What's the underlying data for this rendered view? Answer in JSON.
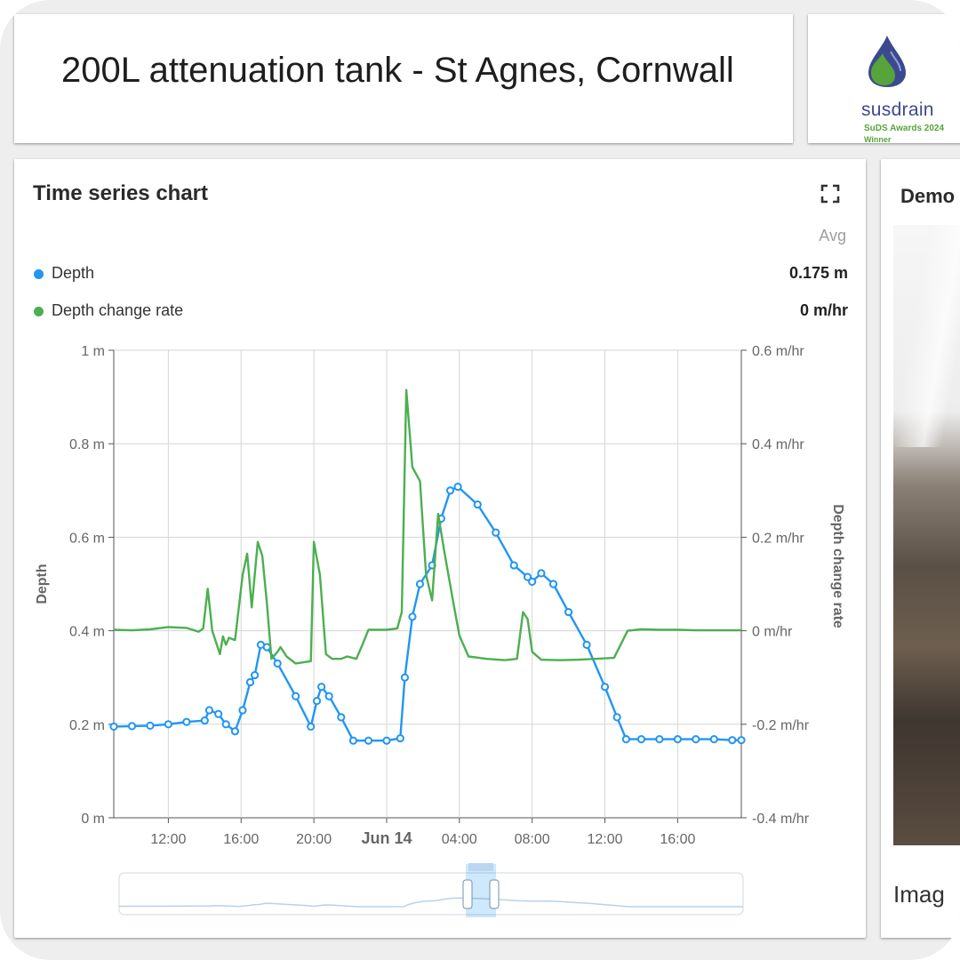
{
  "header": {
    "title": "200L attenuation tank - St Agnes, Cornwall"
  },
  "logo": {
    "wordmark": "susdrain",
    "line1": "SuDS Awards 2024",
    "line2": "Winner",
    "colors": {
      "drop_blue": "#3b4a8f",
      "drop_green": "#56a43a"
    }
  },
  "chart_widget": {
    "title": "Time series chart",
    "expand_icon": "fullscreen-icon",
    "avg_label": "Avg",
    "legend": [
      {
        "name": "Depth",
        "avg": "0.175 m",
        "color": "#2196f3"
      },
      {
        "name": "Depth change rate",
        "avg": "0 m/hr",
        "color": "#4caf50"
      }
    ]
  },
  "side_widget": {
    "title": "Demo",
    "caption": "Imag"
  },
  "chart_data": {
    "type": "line",
    "title": "",
    "xlabel": "",
    "ylabel": "Depth",
    "y2label": "Depth change rate",
    "ylim": [
      0,
      1
    ],
    "y2lim": [
      -0.4,
      0.6
    ],
    "xlim": [
      "2024-06-13T09:00",
      "2024-06-14T19:30"
    ],
    "yticks": [
      "0 m",
      "0.2 m",
      "0.4 m",
      "0.6 m",
      "0.8 m",
      "1 m"
    ],
    "y2ticks": [
      "-0.4 m/hr",
      "-0.2 m/hr",
      "0 m/hr",
      "0.2 m/hr",
      "0.4 m/hr",
      "0.6 m/hr"
    ],
    "xticks": [
      {
        "t": "2024-06-13T12:00",
        "label": "12:00"
      },
      {
        "t": "2024-06-13T16:00",
        "label": "16:00"
      },
      {
        "t": "2024-06-13T20:00",
        "label": "20:00"
      },
      {
        "t": "2024-06-14T00:00",
        "label": "Jun 14"
      },
      {
        "t": "2024-06-14T04:00",
        "label": "04:00"
      },
      {
        "t": "2024-06-14T08:00",
        "label": "08:00"
      },
      {
        "t": "2024-06-14T12:00",
        "label": "12:00"
      },
      {
        "t": "2024-06-14T16:00",
        "label": "16:00"
      }
    ],
    "grid": true,
    "series": [
      {
        "name": "Depth",
        "axis": "left",
        "color": "#2196f3",
        "markers": true,
        "points": [
          [
            "2024-06-13T09:00",
            0.195
          ],
          [
            "2024-06-13T10:00",
            0.196
          ],
          [
            "2024-06-13T11:00",
            0.197
          ],
          [
            "2024-06-13T12:00",
            0.2
          ],
          [
            "2024-06-13T13:00",
            0.205
          ],
          [
            "2024-06-13T14:00",
            0.208
          ],
          [
            "2024-06-13T14:15",
            0.23
          ],
          [
            "2024-06-13T14:45",
            0.222
          ],
          [
            "2024-06-13T15:10",
            0.2
          ],
          [
            "2024-06-13T15:40",
            0.185
          ],
          [
            "2024-06-13T16:05",
            0.23
          ],
          [
            "2024-06-13T16:30",
            0.29
          ],
          [
            "2024-06-13T16:45",
            0.305
          ],
          [
            "2024-06-13T17:05",
            0.37
          ],
          [
            "2024-06-13T17:25",
            0.365
          ],
          [
            "2024-06-13T18:00",
            0.33
          ],
          [
            "2024-06-13T19:00",
            0.26
          ],
          [
            "2024-06-13T19:50",
            0.195
          ],
          [
            "2024-06-13T20:10",
            0.25
          ],
          [
            "2024-06-13T20:25",
            0.28
          ],
          [
            "2024-06-13T20:50",
            0.26
          ],
          [
            "2024-06-13T21:30",
            0.215
          ],
          [
            "2024-06-13T22:10",
            0.165
          ],
          [
            "2024-06-13T23:00",
            0.165
          ],
          [
            "2024-06-14T00:00",
            0.165
          ],
          [
            "2024-06-14T00:45",
            0.17
          ],
          [
            "2024-06-14T01:00",
            0.3
          ],
          [
            "2024-06-14T01:25",
            0.43
          ],
          [
            "2024-06-14T01:50",
            0.5
          ],
          [
            "2024-06-14T02:30",
            0.54
          ],
          [
            "2024-06-14T03:00",
            0.64
          ],
          [
            "2024-06-14T03:30",
            0.7
          ],
          [
            "2024-06-14T03:55",
            0.708
          ],
          [
            "2024-06-14T05:00",
            0.67
          ],
          [
            "2024-06-14T06:00",
            0.61
          ],
          [
            "2024-06-14T07:00",
            0.54
          ],
          [
            "2024-06-14T07:45",
            0.515
          ],
          [
            "2024-06-14T08:00",
            0.505
          ],
          [
            "2024-06-14T08:30",
            0.523
          ],
          [
            "2024-06-14T09:10",
            0.5
          ],
          [
            "2024-06-14T10:00",
            0.44
          ],
          [
            "2024-06-14T11:00",
            0.37
          ],
          [
            "2024-06-14T12:00",
            0.28
          ],
          [
            "2024-06-14T12:40",
            0.215
          ],
          [
            "2024-06-14T13:10",
            0.168
          ],
          [
            "2024-06-14T14:00",
            0.168
          ],
          [
            "2024-06-14T15:00",
            0.168
          ],
          [
            "2024-06-14T16:00",
            0.168
          ],
          [
            "2024-06-14T17:00",
            0.168
          ],
          [
            "2024-06-14T18:00",
            0.168
          ],
          [
            "2024-06-14T19:00",
            0.166
          ],
          [
            "2024-06-14T19:30",
            0.166
          ]
        ]
      },
      {
        "name": "Depth change rate",
        "axis": "right",
        "color": "#4caf50",
        "markers": false,
        "points": [
          [
            "2024-06-13T09:00",
            0.002
          ],
          [
            "2024-06-13T10:00",
            0.001
          ],
          [
            "2024-06-13T11:00",
            0.003
          ],
          [
            "2024-06-13T12:00",
            0.008
          ],
          [
            "2024-06-13T13:00",
            0.006
          ],
          [
            "2024-06-13T13:40",
            -0.002
          ],
          [
            "2024-06-13T13:55",
            0.005
          ],
          [
            "2024-06-13T14:10",
            0.09
          ],
          [
            "2024-06-13T14:25",
            0.0
          ],
          [
            "2024-06-13T14:50",
            -0.05
          ],
          [
            "2024-06-13T15:00",
            -0.012
          ],
          [
            "2024-06-13T15:10",
            -0.03
          ],
          [
            "2024-06-13T15:20",
            -0.015
          ],
          [
            "2024-06-13T15:40",
            -0.02
          ],
          [
            "2024-06-13T16:05",
            0.12
          ],
          [
            "2024-06-13T16:20",
            0.165
          ],
          [
            "2024-06-13T16:35",
            0.05
          ],
          [
            "2024-06-13T16:55",
            0.19
          ],
          [
            "2024-06-13T17:10",
            0.16
          ],
          [
            "2024-06-13T17:25",
            0.06
          ],
          [
            "2024-06-13T17:40",
            -0.06
          ],
          [
            "2024-06-13T18:00",
            -0.045
          ],
          [
            "2024-06-13T18:10",
            -0.035
          ],
          [
            "2024-06-13T18:30",
            -0.055
          ],
          [
            "2024-06-13T19:00",
            -0.07
          ],
          [
            "2024-06-13T19:50",
            -0.065
          ],
          [
            "2024-06-13T20:00",
            0.19
          ],
          [
            "2024-06-13T20:20",
            0.12
          ],
          [
            "2024-06-13T20:40",
            -0.05
          ],
          [
            "2024-06-13T21:00",
            -0.06
          ],
          [
            "2024-06-13T21:30",
            -0.06
          ],
          [
            "2024-06-13T21:50",
            -0.055
          ],
          [
            "2024-06-13T22:20",
            -0.06
          ],
          [
            "2024-06-13T22:40",
            -0.03
          ],
          [
            "2024-06-13T23:00",
            0.002
          ],
          [
            "2024-06-14T00:00",
            0.002
          ],
          [
            "2024-06-14T00:35",
            0.005
          ],
          [
            "2024-06-14T00:50",
            0.04
          ],
          [
            "2024-06-14T01:05",
            0.515
          ],
          [
            "2024-06-14T01:25",
            0.35
          ],
          [
            "2024-06-14T01:50",
            0.32
          ],
          [
            "2024-06-14T02:10",
            0.12
          ],
          [
            "2024-06-14T02:30",
            0.065
          ],
          [
            "2024-06-14T02:50",
            0.25
          ],
          [
            "2024-06-14T03:10",
            0.17
          ],
          [
            "2024-06-14T03:40",
            0.06
          ],
          [
            "2024-06-14T04:00",
            -0.01
          ],
          [
            "2024-06-14T04:30",
            -0.055
          ],
          [
            "2024-06-14T05:30",
            -0.06
          ],
          [
            "2024-06-14T06:30",
            -0.063
          ],
          [
            "2024-06-14T07:10",
            -0.06
          ],
          [
            "2024-06-14T07:30",
            0.04
          ],
          [
            "2024-06-14T07:45",
            0.025
          ],
          [
            "2024-06-14T08:00",
            -0.045
          ],
          [
            "2024-06-14T08:30",
            -0.062
          ],
          [
            "2024-06-14T09:30",
            -0.063
          ],
          [
            "2024-06-14T10:30",
            -0.062
          ],
          [
            "2024-06-14T11:30",
            -0.06
          ],
          [
            "2024-06-14T12:30",
            -0.058
          ],
          [
            "2024-06-14T13:15",
            0.0
          ],
          [
            "2024-06-14T14:00",
            0.003
          ],
          [
            "2024-06-14T15:00",
            0.002
          ],
          [
            "2024-06-14T16:00",
            0.002
          ],
          [
            "2024-06-14T17:00",
            0.001
          ],
          [
            "2024-06-14T18:00",
            0.001
          ],
          [
            "2024-06-14T19:00",
            0.001
          ],
          [
            "2024-06-14T19:30",
            0.001
          ]
        ]
      }
    ],
    "navigator": {
      "selected_range": [
        "2024-06-13T09:00",
        "2024-06-14T19:30"
      ]
    }
  }
}
